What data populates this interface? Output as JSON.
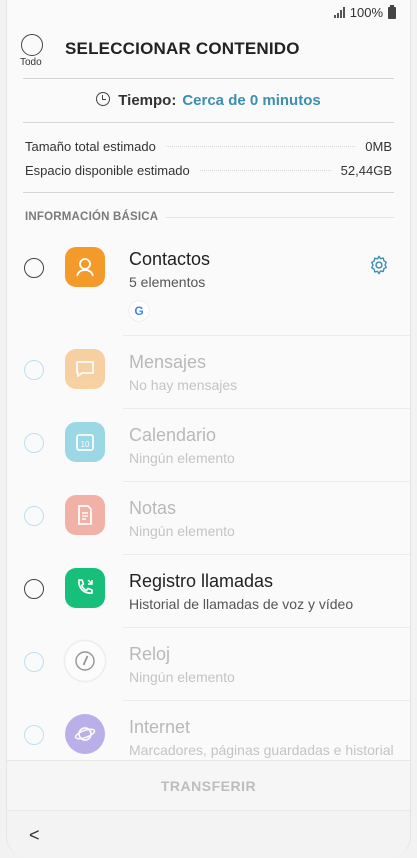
{
  "status": {
    "battery": "100%"
  },
  "header": {
    "select_all_label": "Todo",
    "title": "SELECCIONAR CONTENIDO"
  },
  "time": {
    "label": "Tiempo:",
    "value": "Cerca de 0 minutos"
  },
  "estimates": {
    "total_label": "Tamaño total estimado",
    "total_value": "0MB",
    "free_label": "Espacio disponible estimado",
    "free_value": "52,44GB"
  },
  "section_title": "INFORMACIÓN BÁSICA",
  "items": [
    {
      "name": "Contactos",
      "sub": "5 elementos",
      "icon": "contacts-icon",
      "color": "#f39a2a",
      "enabled": true
    },
    {
      "name": "Mensajes",
      "sub": "No hay mensajes",
      "icon": "messages-icon",
      "color": "#f6a84a",
      "enabled": false
    },
    {
      "name": "Calendario",
      "sub": "Ningún elemento",
      "icon": "calendar-icon",
      "color": "#3fb6cf",
      "enabled": false
    },
    {
      "name": "Notas",
      "sub": "Ningún elemento",
      "icon": "notes-icon",
      "color": "#ea6a55",
      "enabled": false
    },
    {
      "name": "Registro llamadas",
      "sub": "Historial de llamadas de voz y vídeo",
      "icon": "call-log-icon",
      "color": "#16c07a",
      "enabled": true
    },
    {
      "name": "Reloj",
      "sub": "Ningún elemento",
      "icon": "clock-icon",
      "color": "#ffffff",
      "enabled": false
    },
    {
      "name": "Internet",
      "sub": "Marcadores, páginas guardadas e historial",
      "icon": "internet-icon",
      "color": "#7b66d8",
      "enabled": false
    }
  ],
  "google_badge": "G",
  "bottom": {
    "transfer_label": "TRANSFERIR"
  },
  "nav": {
    "back_glyph": "<"
  }
}
